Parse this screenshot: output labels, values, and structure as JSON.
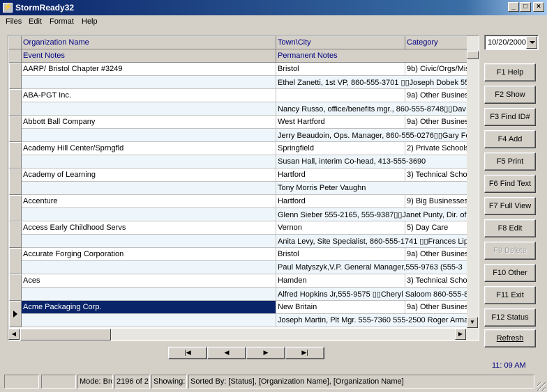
{
  "window": {
    "title": "StormReady32"
  },
  "menu": [
    "Files",
    "Edit",
    "Format",
    "Help"
  ],
  "grid": {
    "columns_line1": [
      "Organization Name",
      "Town\\City",
      "Category"
    ],
    "columns_line2": [
      "Event Notes",
      "Permanent Notes"
    ],
    "records": [
      {
        "org": "AARP/ Bristol Chapter #3249",
        "town": "Bristol",
        "category": "9b) Civic/Orgs/Mis",
        "event_notes": "",
        "permanent_notes": "Ethel Zanetti, 1st VP, 860-555-3701 ▯▯Joseph Dobek 55"
      },
      {
        "org": "ABA-PGT Inc.",
        "town": "",
        "category": "9a) Other Busines",
        "event_notes": "",
        "permanent_notes": "Nancy Russo, office/benefits mgr., 860-555-8748▯▯Dav"
      },
      {
        "org": "Abbott Ball Company",
        "town": "West Hartford",
        "category": "9a) Other Busines",
        "event_notes": "",
        "permanent_notes": "Jerry Beaudoin, Ops. Manager, 860-555-0276▯▯Gary Fo"
      },
      {
        "org": "Academy Hill Center/Sprngfld",
        "town": "Springfield",
        "category": "2) Private Schools",
        "event_notes": "",
        "permanent_notes": "Susan Hall, interim Co-head, 413-555-3690"
      },
      {
        "org": "Academy of Learning",
        "town": "Hartford",
        "category": "3) Technical Scho",
        "event_notes": "",
        "permanent_notes": "Tony Morris Peter Vaughn"
      },
      {
        "org": "Accenture",
        "town": "Hartford",
        "category": "9) Big Businesses",
        "event_notes": "",
        "permanent_notes": "Glenn Sieber 555-2165, 555-9387▯▯Janet Punty, Dir. of"
      },
      {
        "org": "Access Early Childhood Servs",
        "town": "Vernon",
        "category": "5) Day Care",
        "event_notes": "",
        "permanent_notes": "Anita Levy, Site Specialist, 860-555-1741 ▯▯Frances Lip"
      },
      {
        "org": "Accurate Forging Corporation",
        "town": "Bristol",
        "category": "9a) Other Busines",
        "event_notes": "",
        "permanent_notes": "Paul Matyszyk,V.P. General Manager,555-9763     (555-3"
      },
      {
        "org": "Aces",
        "town": "Hamden",
        "category": "3) Technical Scho",
        "event_notes": "",
        "permanent_notes": "Alfred Hopkins Jr,555-9575  ▯▯Cheryl Saloom 860-555-8"
      },
      {
        "org": "Acme Packaging Corp.",
        "town": "New Britain",
        "category": "9a) Other Busines",
        "event_notes": "",
        "permanent_notes": "Joseph Martin, Plt Mgr. 555-7360    555-2500 Roger Arma"
      }
    ]
  },
  "navigation": [
    "|◀",
    "◀",
    "▶",
    "▶|"
  ],
  "date_field": "10/20/2000",
  "function_keys": [
    {
      "label": "F1 Help",
      "enabled": true
    },
    {
      "label": "F2 Show",
      "enabled": true
    },
    {
      "label": "F3 Find ID#",
      "enabled": true
    },
    {
      "label": "F4 Add",
      "enabled": true
    },
    {
      "label": "F5 Print",
      "enabled": true
    },
    {
      "label": "F6 Find Text",
      "enabled": true
    },
    {
      "label": "F7 Full  View",
      "enabled": true
    },
    {
      "label": "F8 Edit",
      "enabled": true
    },
    {
      "label": "F9 Delete",
      "enabled": false
    },
    {
      "label": "F10 Other",
      "enabled": true
    },
    {
      "label": "F11 Exit",
      "enabled": true
    },
    {
      "label": "F12 Status",
      "enabled": true
    }
  ],
  "refresh_label": "Refresh",
  "clock": "11: 09 AM",
  "status_bar": [
    "",
    "",
    "Mode: Bro",
    "2196 of 2",
    "Showing: .",
    "Sorted By: [Status], [Organization Name], [Organization Name]"
  ],
  "colors": {
    "title_bar": "#0a246a",
    "selection": "#0a246a",
    "header_text": "#000080",
    "alt_row": "#eef6fb"
  }
}
